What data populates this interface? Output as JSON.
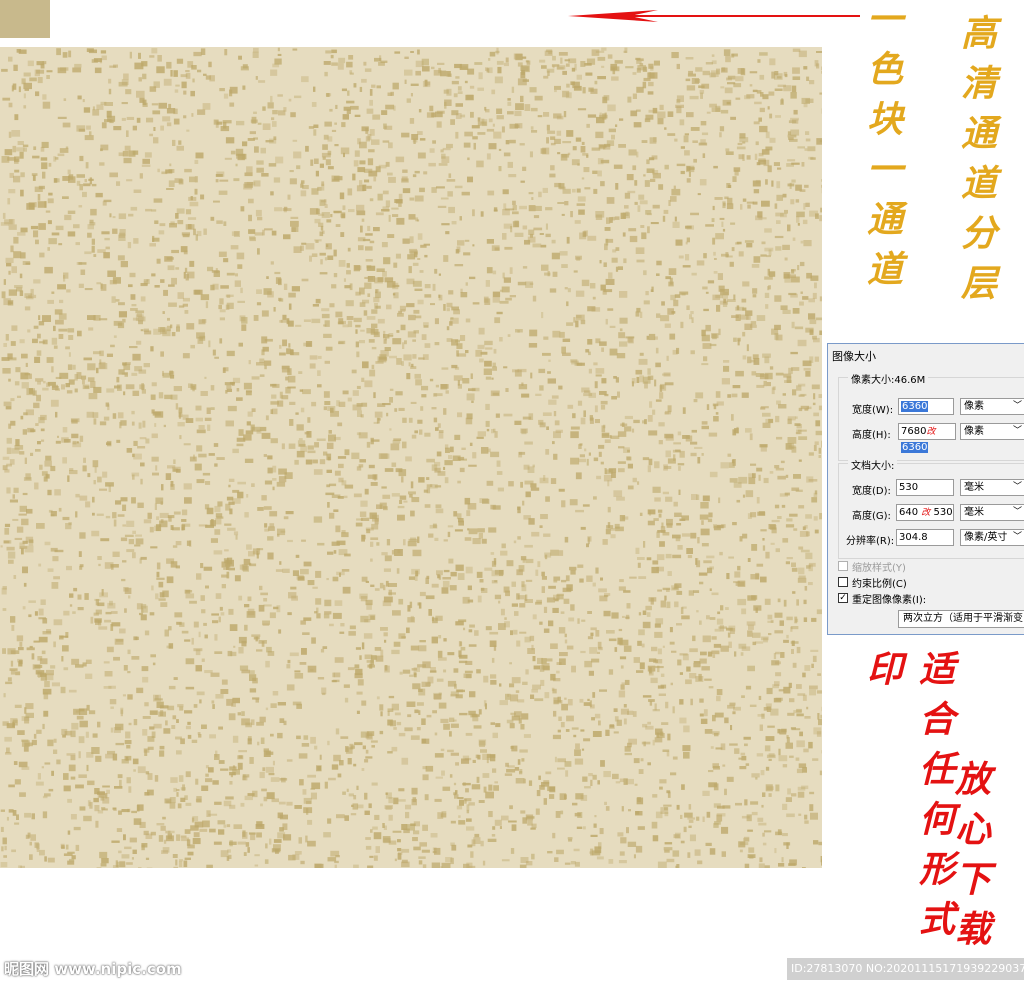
{
  "annotations": {
    "gold_left": "一色块一通道",
    "gold_right": "高清通道分层",
    "red_left": "适合任何形式印",
    "red_right": "放心下载"
  },
  "colors": {
    "texture_base": "#e6dcbf",
    "texture_speckle": "#bda86a",
    "swatch": "#c8b98c",
    "arrow": "#e41212",
    "gold_text": "#e3a81e",
    "red_text": "#e41212"
  },
  "dialog": {
    "title": "图像大小",
    "pixel_size_label": "像素大小:46.6M",
    "width_label": "宽度(W):",
    "width_value": "6360",
    "width_unit": "像素",
    "height_label": "高度(H):",
    "height_old": "7680",
    "height_mark": "改",
    "height_value": "6360",
    "height_unit": "像素",
    "doc_size_label": "文档大小:",
    "doc_width_label": "宽度(D):",
    "doc_width_value": "530",
    "doc_width_unit": "毫米",
    "doc_height_label": "高度(G):",
    "doc_height_old": "640",
    "doc_height_mark": "改",
    "doc_height_value": "530",
    "doc_height_unit": "毫米",
    "resolution_label": "分辨率(R):",
    "resolution_value": "304.8",
    "resolution_unit": "像素/英寸",
    "scale_styles_label": "缩放样式(Y)",
    "constrain_label": "约束比例(C)",
    "resample_label": "重定图像像素(I):",
    "resample_method": "两次立方（适用于平滑渐变"
  },
  "watermark": {
    "left": "昵图网 www.nipic.com",
    "right": "ID:27813070 NO:20201115171939229037"
  }
}
